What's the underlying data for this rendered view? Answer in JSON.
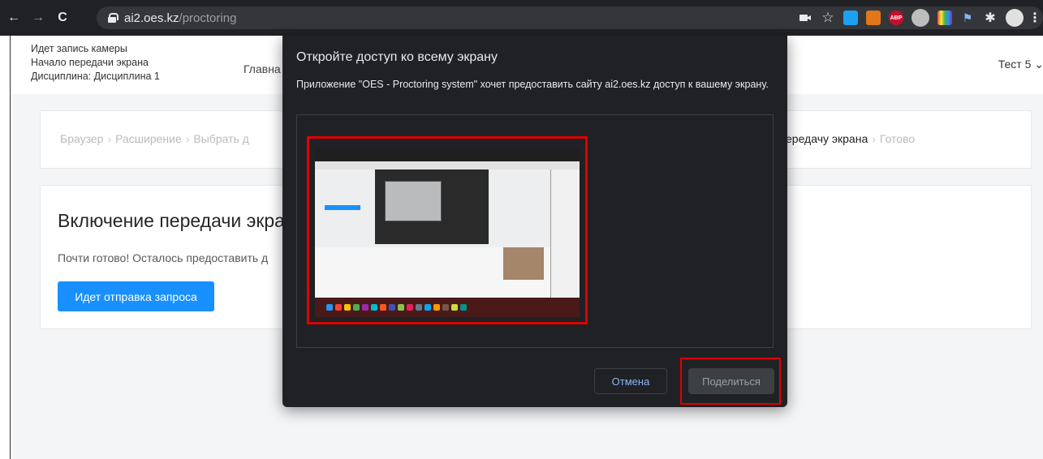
{
  "browser": {
    "url_domain": "ai2.oes.kz",
    "url_path": "/proctoring",
    "back": "←",
    "forward": "→",
    "reload": "C",
    "extensions": [
      {
        "name": "camera-icon",
        "label": "",
        "color": "#202124"
      },
      {
        "name": "star-icon",
        "label": "☆",
        "color": "#202124"
      },
      {
        "name": "extension-blue-icon",
        "label": "",
        "color": "#1da1f2"
      },
      {
        "name": "metamask-icon",
        "label": "",
        "color": "#e2761b"
      },
      {
        "name": "adblock-icon",
        "label": "ABP",
        "color": "#c70d2c"
      },
      {
        "name": "profile-extension-icon",
        "label": "",
        "color": "#bdbdbd"
      },
      {
        "name": "color-grid-icon",
        "label": "",
        "color": "#9c27b0"
      },
      {
        "name": "pin-extension-icon",
        "label": "",
        "color": "#202124"
      },
      {
        "name": "puzzle-icon",
        "label": "",
        "color": "#202124"
      },
      {
        "name": "avatar-icon",
        "label": "",
        "color": "#e0e0e0"
      }
    ]
  },
  "header": {
    "status": [
      "Идет запись камеры",
      "Начало передачи экрана",
      "Дисциплина: Дисциплина 1"
    ],
    "nav_home": "Главна",
    "user": "Тест 5 ⌄"
  },
  "steps": {
    "left": [
      "Браузер",
      "Расширение",
      "Выбрать д"
    ],
    "right_active": "ередачу экрана",
    "right_last": "Готово"
  },
  "main": {
    "title": "Включение передачи экра",
    "text": "Почти готово! Осталось предоставить д",
    "button": "Идет отправка запроса"
  },
  "dialog": {
    "title": "Откройте доступ ко всему экрану",
    "description": "Приложение \"OES - Proctoring system\" хочет предоставить сайту ai2.oes.kz доступ к вашему экрану.",
    "cancel": "Отмена",
    "share": "Поделиться"
  },
  "colors": {
    "primary": "#1890ff",
    "highlight": "#e00000",
    "dialog_bg": "#202124"
  }
}
